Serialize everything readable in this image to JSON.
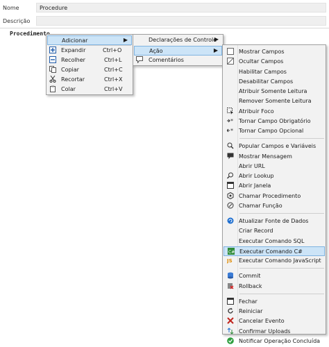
{
  "form": {
    "name_label": "Nome",
    "name_value": "Procedure",
    "description_label": "Descrição",
    "description_value": ""
  },
  "editor": {
    "root_node": "Procedimento"
  },
  "context_menu": {
    "add": "Adicionar",
    "expand": {
      "label": "Expandir",
      "shortcut": "Ctrl+O"
    },
    "collapse": {
      "label": "Recolher",
      "shortcut": "Ctrl+L"
    },
    "copy": {
      "label": "Copiar",
      "shortcut": "Ctrl+C"
    },
    "cut": {
      "label": "Recortar",
      "shortcut": "Ctrl+X"
    },
    "paste": {
      "label": "Colar",
      "shortcut": "Ctrl+V"
    }
  },
  "add_submenu": {
    "control_declarations": "Declarações de Controle",
    "action": "Ação",
    "comments": "Comentários"
  },
  "action_submenu": {
    "groups": [
      [
        "Mostrar Campos",
        "Ocultar Campos",
        "Habilitar Campos",
        "Desabilitar Campos",
        "Atribuir Somente Leitura",
        "Remover Somente Leitura",
        "Atribuir Foco",
        "Tornar Campo Obrigatório",
        "Tornar Campo Opcional"
      ],
      [
        "Popular Campos e Variáveis",
        "Mostrar Mensagem",
        "Abrir URL",
        "Abrir Lookup",
        "Abrir Janela",
        "Chamar Procedimento",
        "Chamar Função"
      ],
      [
        "Atualizar Fonte de Dados",
        "Criar Record",
        "Executar Comando SQL",
        "Executar Comando C#",
        "Executar Comando JavaScript"
      ],
      [
        "Commit",
        "Rollback"
      ],
      [
        "Fechar",
        "Reiniciar",
        "Cancelar Evento",
        "Confirmar Uploads",
        "Notificar Operação Concluída"
      ]
    ],
    "icons": [
      [
        "show-fields-icon",
        "hide-fields-icon",
        "",
        "",
        "",
        "",
        "focus-icon",
        "required-field-icon",
        "optional-field-icon"
      ],
      [
        "populate-fields-icon",
        "message-icon",
        "",
        "lookup-icon",
        "window-icon",
        "call-procedure-icon",
        "call-function-icon"
      ],
      [
        "refresh-datasource-icon",
        "",
        "",
        "csharp-icon",
        "javascript-icon"
      ],
      [
        "commit-icon",
        "rollback-icon"
      ],
      [
        "close-icon",
        "restart-icon",
        "cancel-icon",
        "confirm-uploads-icon",
        "notify-done-icon"
      ]
    ],
    "highlighted": "Executar Comando C#"
  },
  "colors": {
    "highlight_bg": "#cce4f7",
    "highlight_border": "#7fb3e0",
    "menu_bg": "#f2f2f2"
  }
}
